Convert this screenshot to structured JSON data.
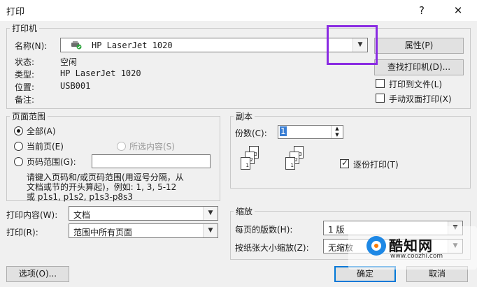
{
  "window": {
    "title": "打印",
    "help": "?",
    "close": "✕"
  },
  "printer": {
    "group_title": "打印机",
    "name_label": "名称(N):",
    "name_value": "HP LaserJet 1020",
    "status_label": "状态:",
    "status_value": "空闲",
    "type_label": "类型:",
    "type_value": "HP LaserJet 1020",
    "where_label": "位置:",
    "where_value": "USB001",
    "comment_label": "备注:",
    "properties_btn": "属性(P)",
    "find_btn": "查找打印机(D)...",
    "print_to_file": "打印到文件(L)",
    "manual_duplex": "手动双面打印(X)"
  },
  "range": {
    "group_title": "页面范围",
    "all": "全部(A)",
    "current": "当前页(E)",
    "selection": "所选内容(S)",
    "pages": "页码范围(G):",
    "hint_line1": "请键入页码和/或页码范围(用逗号分隔，从",
    "hint_line2": "文档或节的开头算起)，例如: 1, 3, 5-12",
    "hint_line3": "或 p1s1, p1s2, p1s3-p8s3"
  },
  "copies": {
    "group_title": "副本",
    "count_label": "份数(C):",
    "count_value": "1",
    "collate": "逐份打印(T)",
    "sheet_numbers": [
      "1",
      "2",
      "3"
    ]
  },
  "print_what": {
    "label": "打印内容(W):",
    "value": "文档"
  },
  "print_opt": {
    "label": "打印(R):",
    "value": "范围中所有页面"
  },
  "zoom": {
    "group_title": "缩放",
    "pages_per_sheet_label": "每页的版数(H):",
    "pages_per_sheet_value": "1 版",
    "scale_label": "按纸张大小缩放(Z):",
    "scale_value": "无缩放"
  },
  "buttons": {
    "options": "选项(O)...",
    "ok": "确定",
    "cancel": "取消"
  },
  "watermark": {
    "brand": "酷知网",
    "url": "www.coozhi.com"
  },
  "colors": {
    "highlight": "#8a2be2",
    "accent": "#0078d7"
  }
}
